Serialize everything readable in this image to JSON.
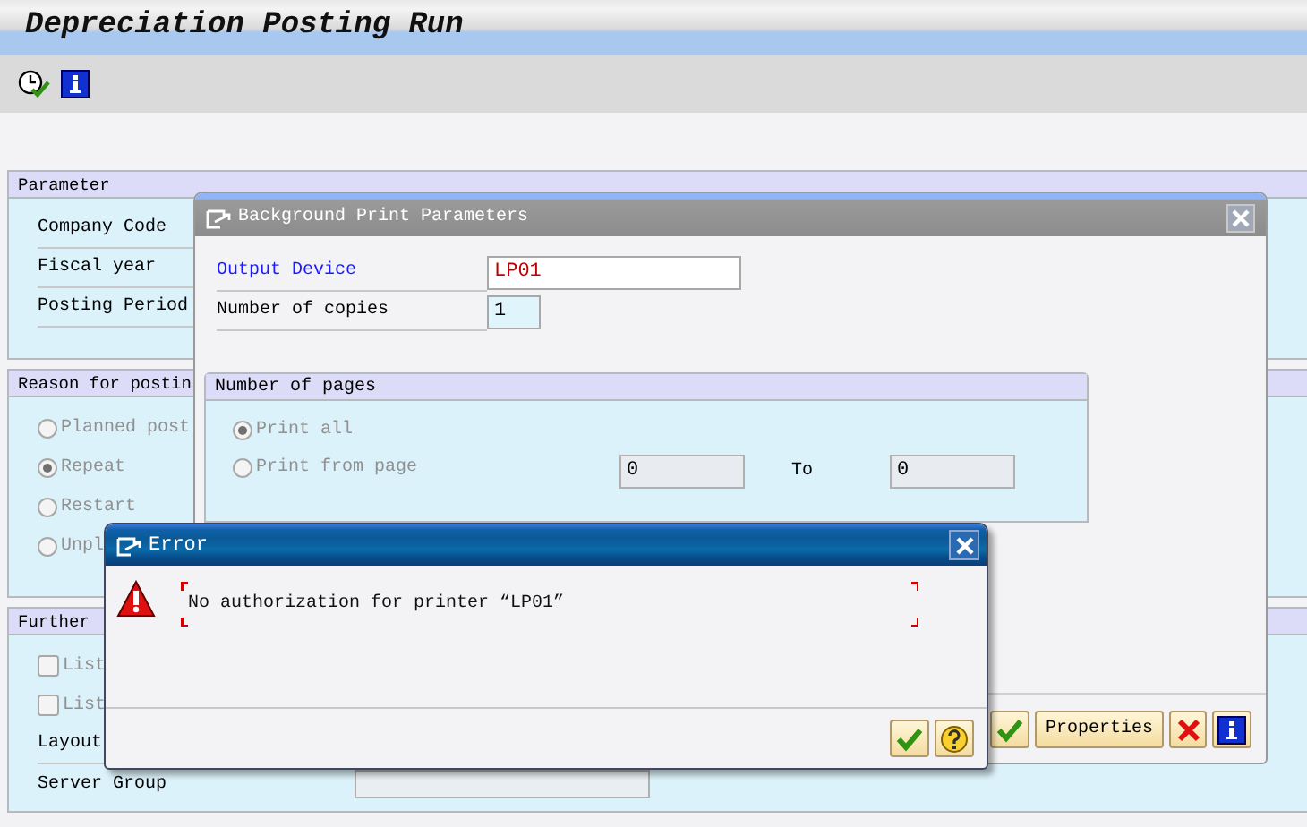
{
  "window": {
    "title": "Depreciation Posting Run"
  },
  "groups": [
    {
      "title": "Parameter",
      "items": [
        {
          "kind": "label",
          "label": "Company Code"
        },
        {
          "kind": "label",
          "label": "Fiscal year"
        },
        {
          "kind": "label",
          "label": "Posting Period"
        }
      ]
    },
    {
      "title": "Reason for postin",
      "items": [
        {
          "kind": "radio",
          "label": "Planned post",
          "selected": false,
          "disabled": true
        },
        {
          "kind": "radio",
          "label": "Repeat",
          "selected": true,
          "disabled": true
        },
        {
          "kind": "radio",
          "label": "Restart",
          "selected": false,
          "disabled": true
        },
        {
          "kind": "radio",
          "label": "Unpl",
          "selected": false,
          "disabled": true
        }
      ]
    },
    {
      "title": "Further",
      "items": [
        {
          "kind": "checkbox",
          "label": "List",
          "checked": false,
          "disabled": true
        },
        {
          "kind": "checkbox",
          "label": "List",
          "checked": false,
          "disabled": true
        },
        {
          "kind": "label",
          "label": "Layout"
        },
        {
          "kind": "field",
          "label": "Server Group"
        }
      ]
    }
  ],
  "print_dialog": {
    "title": "Background Print Parameters",
    "fields": [
      {
        "label": "Output Device",
        "value": "LP01",
        "highlighted": true,
        "error": true
      },
      {
        "label": "Number of copies",
        "value": "1",
        "highlighted": false,
        "error": false
      }
    ],
    "pages": {
      "title": "Number of pages",
      "options": [
        {
          "label": "Print all",
          "selected": true,
          "disabled": true
        },
        {
          "label": "Print from page",
          "selected": false,
          "disabled": true,
          "from": "0",
          "to_label": "To",
          "to": "0"
        }
      ]
    },
    "buttons": [
      {
        "kind": "ok"
      },
      {
        "kind": "text",
        "label": "Properties"
      },
      {
        "kind": "cancel"
      },
      {
        "kind": "info"
      }
    ]
  },
  "error_dialog": {
    "title": "Error",
    "message": "No authorization for printer “LP01”",
    "buttons": [
      {
        "kind": "ok"
      },
      {
        "kind": "help"
      }
    ]
  }
}
